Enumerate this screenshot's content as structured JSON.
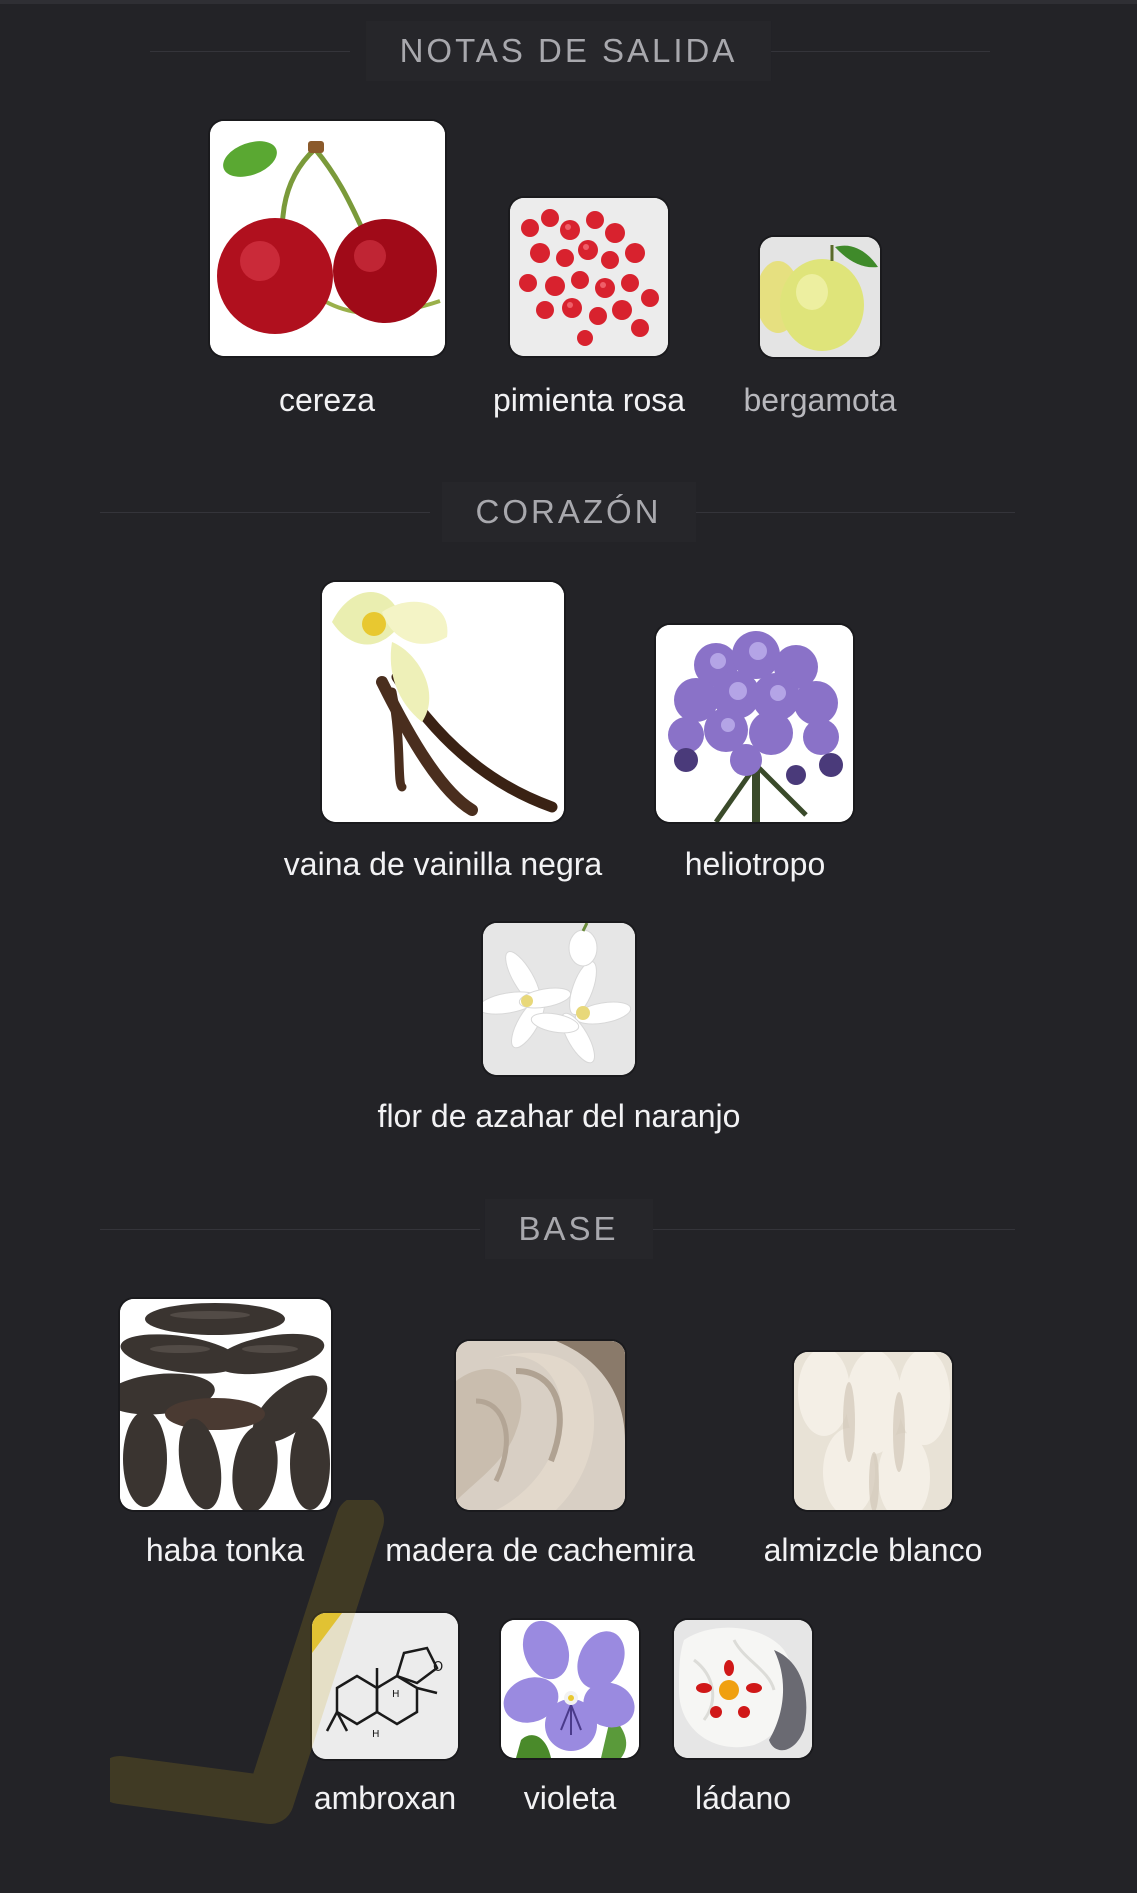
{
  "sections": {
    "top": {
      "title": "NOTAS DE SALIDA"
    },
    "heart": {
      "title": "CORAZÓN"
    },
    "base": {
      "title": "BASE"
    }
  },
  "notes": {
    "cereza": "cereza",
    "pimienta_rosa": "pimienta rosa",
    "bergamota": "bergamota",
    "vainilla": "vaina de vainilla negra",
    "heliotropo": "heliotropo",
    "azahar": "flor de azahar del naranjo",
    "tonka": "haba tonka",
    "cachemira": "madera de cachemira",
    "almizcle": "almizcle blanco",
    "ambroxan": "ambroxan",
    "violeta": "violeta",
    "ladano": "ládano"
  },
  "colors": {
    "background": "#232327",
    "header_text": "#a8a8ad",
    "label_text": "#f2f2f4",
    "swoosh": "#c9a81a"
  }
}
